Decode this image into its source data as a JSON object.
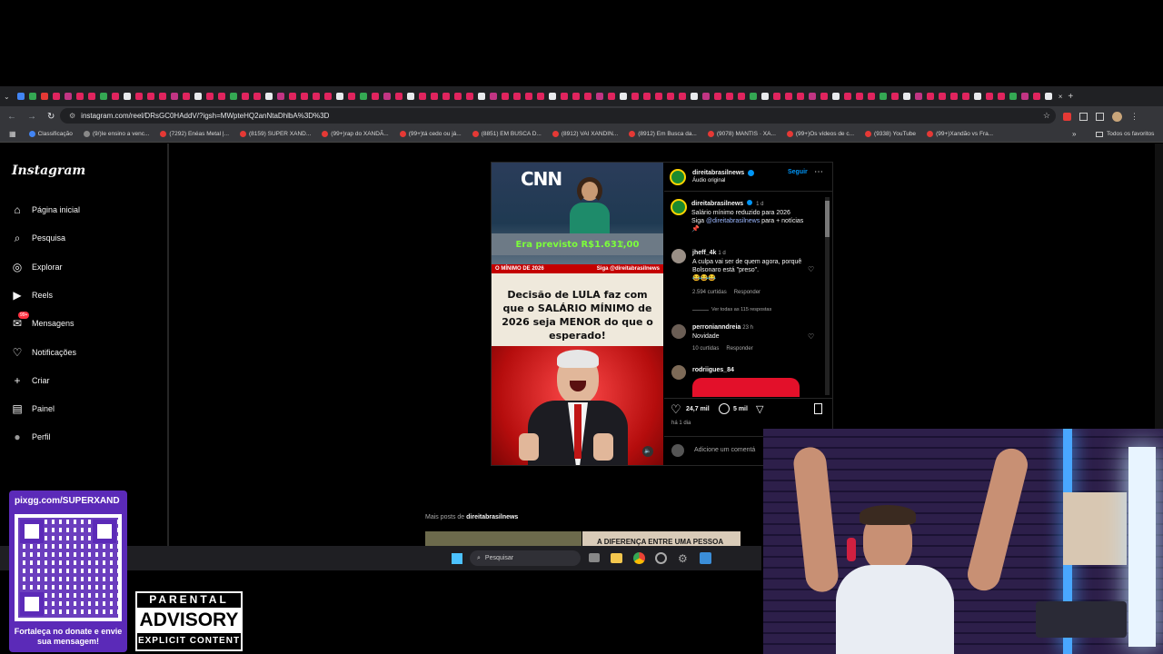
{
  "browser": {
    "url": "instagram.com/reel/DRsGC0HAddV/?igsh=MWpteHQ2anNtaDhlbA%3D%3D",
    "bookmarks": [
      "Classificação",
      "(9/)Ie ensino a venc...",
      "(7292) Enéas Metal |...",
      "(8159) SUPER XAND...",
      "(99+)rap do XANDÃ...",
      "(99+)tá cedo ou já...",
      "(8851) EM BUSCA D...",
      "(8912) VAI XANDIN...",
      "(8912) Em Busca da...",
      "(9078) MANTIS · XA...",
      "(99+)Os vídeos de c...",
      "(9338) YouTube",
      "(99+)Xandão vs Fra..."
    ],
    "all_bookmarks": "Todos os favoritos"
  },
  "instagram": {
    "logo": "Instagram",
    "nav": [
      {
        "label": "Página inicial",
        "icon": "home-icon"
      },
      {
        "label": "Pesquisa",
        "icon": "search-icon"
      },
      {
        "label": "Explorar",
        "icon": "compass-icon"
      },
      {
        "label": "Reels",
        "icon": "reels-icon"
      },
      {
        "label": "Mensagens",
        "icon": "messenger-icon"
      },
      {
        "label": "Notificações",
        "icon": "heart-icon"
      },
      {
        "label": "Criar",
        "icon": "plus-icon"
      },
      {
        "label": "Painel",
        "icon": "dashboard-icon"
      },
      {
        "label": "Perfil",
        "icon": "avatar-icon"
      }
    ],
    "messages_badge": "99+",
    "post": {
      "username": "direitabrasilnews",
      "follow": "Seguir",
      "audio": "Áudio original",
      "caption_user": "direitabrasilnews",
      "caption_time": "1 d",
      "caption_line1": "Salário mínimo reduzido para 2026",
      "caption_line2_pre": "Siga",
      "caption_handle": "@direitabrasilnews",
      "caption_line2_post": "para + notícias",
      "caption_emoji": "📌",
      "comments": [
        {
          "user": "jheff_4k",
          "time": "1 d",
          "text": "A culpa vai ser de quem agora, porquê Bolsonaro está \"preso\".",
          "emoji": "😂😂😂",
          "likes": "2.594 curtidas",
          "reply": "Responder"
        },
        {
          "user": "perronianndreia",
          "time": "23 h",
          "text": "Novidade",
          "likes": "10 curtidas",
          "reply": "Responder"
        },
        {
          "user": "rodriigues_84"
        }
      ],
      "view_replies": "Ver todas as 115 respostas",
      "likes": "24,7 mil",
      "comments_count": "5 mil",
      "date": "há 1 dia",
      "add_comment": "Adicione um comentá"
    },
    "media": {
      "network": "CNN",
      "banner": "Era previsto R$1.631,00",
      "ticker_left": "O MÍNIMO DE 2026",
      "ticker_right": "Siga @direitabrasilnews",
      "headline": "Decisão de LULA faz com que o SALÁRIO MÍNIMO de 2026 seja MENOR do que o esperado!"
    },
    "more_posts_pre": "Mais posts de",
    "more_posts_user": "direitabrasilnews",
    "thumb2_text": "A DIFERENÇA ENTRE UMA PESSOA"
  },
  "taskbar": {
    "search": "Pesquisar"
  },
  "overlay": {
    "qr_url": "pixgg.com/SUPERXAND",
    "qr_text": "Fortaleça no donate e envie sua mensagem!",
    "advisory_top": "PARENTAL",
    "advisory_mid": "ADVISORY",
    "advisory_bottom": "EXPLICIT CONTENT"
  },
  "colors": {
    "accent": "#0095f6",
    "tab_red": "#e0245e",
    "qr_bg": "#5b2ab8"
  }
}
